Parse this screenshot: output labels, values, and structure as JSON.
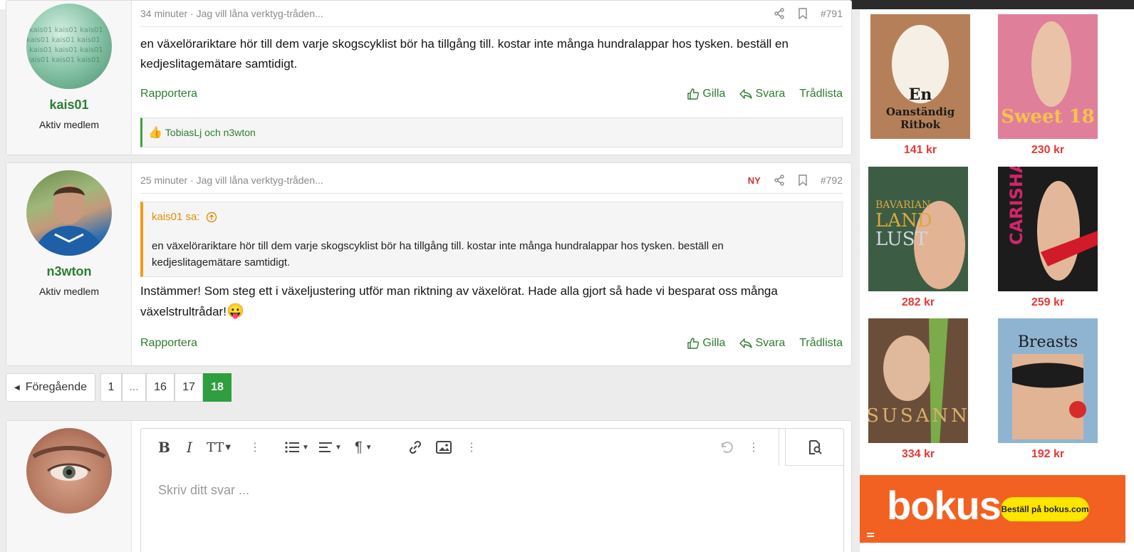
{
  "posts": [
    {
      "username": "kais01",
      "user_title": "Aktiv medlem",
      "time": "34 minuter",
      "thread": "Jag vill låna verktyg-tråden...",
      "number": "#791",
      "body": "en växelörariktare hör till dem varje skogscyklist bör ha tillgång till. kostar inte många hundralappar hos tysken. beställ en kedjeslitagemätare samtidigt.",
      "likes": "TobiasLj och n3wton"
    },
    {
      "username": "n3wton",
      "user_title": "Aktiv medlem",
      "time": "25 minuter",
      "thread": "Jag vill låna verktyg-tråden...",
      "new_badge": "NY",
      "number": "#792",
      "quote_author": "kais01 sa:",
      "quote_body": "en växelörariktare hör till dem varje skogscyklist bör ha tillgång till. kostar inte många hundralappar hos tysken. beställ en kedjeslitagemätare samtidigt.",
      "body": "Instämmer! Som steg ett i växeljustering utför man riktning av växelörat. Hade alla gjort så hade vi besparat oss många växelstrultrådar!",
      "emoji": "😛"
    }
  ],
  "actions": {
    "report": "Rapportera",
    "like": "Gilla",
    "reply": "Svara",
    "thread_list": "Trådlista"
  },
  "pagination": {
    "prev": "Föregående",
    "pages": [
      "1",
      "...",
      "16",
      "17",
      "18"
    ],
    "current": "18"
  },
  "editor": {
    "placeholder": "Skriv ditt svar ..."
  },
  "books": [
    {
      "title": "En Oanständig Ritbok",
      "price": "141 kr",
      "color": "#b07a52"
    },
    {
      "title": "Sweet 18",
      "price": "230 kr",
      "color": "#d8768e"
    },
    {
      "title": "Bavarian Land Lust",
      "price": "282 kr",
      "color": "#3d5c44"
    },
    {
      "title": "Carisha",
      "price": "259 kr",
      "color": "#1c1c1c"
    },
    {
      "title": "Susann",
      "price": "334 kr",
      "color": "#6a4e3a"
    },
    {
      "title": "Breasts",
      "price": "192 kr",
      "color": "#7fa8c9"
    }
  ],
  "ad": {
    "logo": "bokus",
    "cta": "Beställ på bokus.com"
  }
}
